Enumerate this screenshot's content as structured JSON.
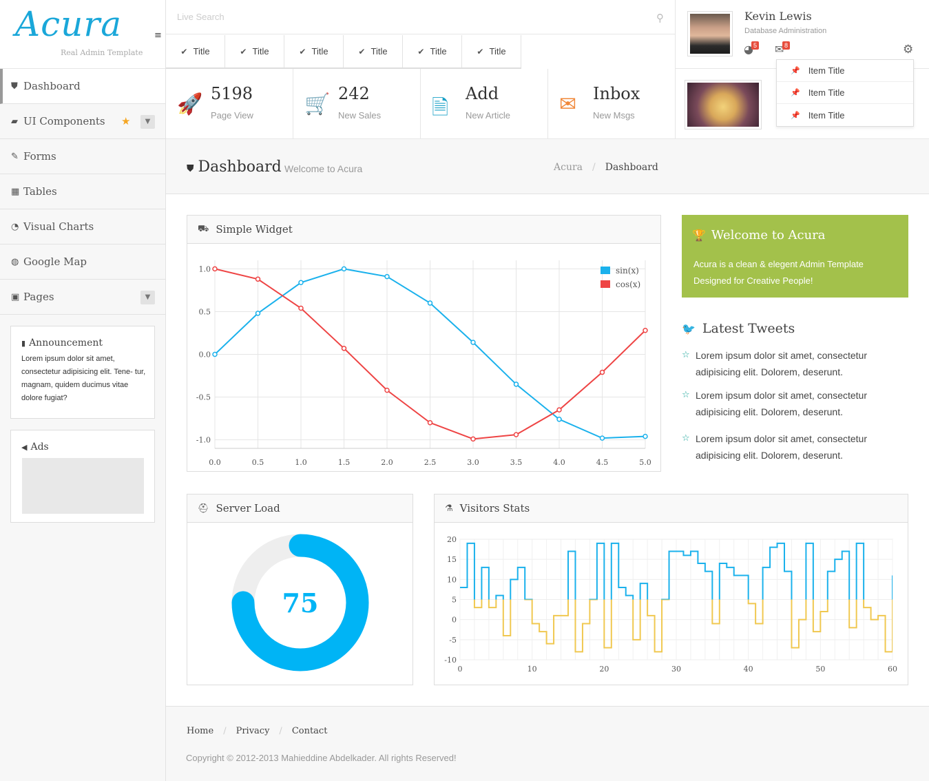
{
  "brand": {
    "logo": "Acura",
    "tagline": "Real Admin Template"
  },
  "search": {
    "placeholder": "Live Search"
  },
  "toolbar_tabs": [
    "Title",
    "Title",
    "Title",
    "Title",
    "Title",
    "Title"
  ],
  "user": {
    "name": "Kevin Lewis",
    "role": "Database Administration",
    "notifications_count": "5",
    "messages_count": "8"
  },
  "dropdown": {
    "items": [
      "Item Title",
      "Item Title",
      "Item Title"
    ]
  },
  "sidebar": {
    "items": [
      {
        "label": "Dashboard",
        "icon": "shield-icon"
      },
      {
        "label": "UI Components",
        "icon": "briefcase-icon"
      },
      {
        "label": "Forms",
        "icon": "edit-icon"
      },
      {
        "label": "Tables",
        "icon": "table-icon"
      },
      {
        "label": "Visual Charts",
        "icon": "dashboard-icon"
      },
      {
        "label": "Google Map",
        "icon": "globe-icon"
      },
      {
        "label": "Pages",
        "icon": "gift-icon"
      }
    ],
    "announcement": {
      "title": "Announcement",
      "text": "Lorem ipsum dolor sit amet, consectetur adipisicing elit. Tene- tur, magnam, quidem ducimus vitae dolore fugiat?"
    },
    "ads": {
      "title": "Ads"
    }
  },
  "stats": [
    {
      "value": "5198",
      "label": "Page View",
      "color": "#e74c3c",
      "icon": "rocket-icon"
    },
    {
      "value": "242",
      "label": "New Sales",
      "color": "#7ecfb0",
      "icon": "cart-icon"
    },
    {
      "value": "Add",
      "label": "New Article",
      "color": "#1ba1c7",
      "icon": "document-icon"
    },
    {
      "value": "Inbox",
      "label": "New Msgs",
      "color": "#f0883a",
      "icon": "envelope-icon"
    }
  ],
  "page": {
    "title": "Dashboard",
    "subtitle": "Welcome to Acura",
    "breadcrumb": [
      "Acura",
      "Dashboard"
    ]
  },
  "widgets": {
    "simple": {
      "title": "Simple Widget"
    },
    "server": {
      "title": "Server Load"
    },
    "visitors": {
      "title": "Visitors Stats"
    }
  },
  "welcome": {
    "title": "Welcome to Acura",
    "text": "Acura is a clean & elegent Admin Template Designed for Creative People!"
  },
  "tweets": {
    "title": "Latest Tweets",
    "items": [
      "Lorem ipsum dolor sit amet, consectetur adipisicing elit. Dolorem, deserunt.",
      "Lorem ipsum dolor sit amet, consectetur adipisicing elit. Dolorem, deserunt.",
      "Lorem ipsum dolor sit amet, consectetur adipisicing elit. Dolorem, deserunt."
    ]
  },
  "footer": {
    "links": [
      "Home",
      "Privacy",
      "Contact"
    ],
    "copyright": "Copyright © 2012-2013 Mahieddine Abdelkader. All rights Reserved!"
  },
  "colors": {
    "accent": "#1aa7d9",
    "sin": "#1ab1ec",
    "cos": "#ee4444",
    "gauge": "#00b4f5",
    "welcome": "#a3c14b",
    "stair_pos": "#1ab1ec",
    "stair_neg": "#f0c850"
  },
  "chart_data": [
    {
      "type": "line",
      "title": "",
      "x": [
        0.0,
        0.5,
        1.0,
        1.5,
        2.0,
        2.5,
        3.0,
        3.5,
        4.0,
        4.5,
        5.0
      ],
      "x_ticks": [
        "0.0",
        "0.5",
        "1.0",
        "1.5",
        "2.0",
        "2.5",
        "3.0",
        "3.5",
        "4.0",
        "4.5",
        "5.0"
      ],
      "y_ticks": [
        "1.0",
        "0.5",
        "0.0",
        "-0.5",
        "-1.0"
      ],
      "xlim": [
        0,
        5
      ],
      "ylim": [
        -1.1,
        1.1
      ],
      "grid": true,
      "legend": "top-right",
      "series": [
        {
          "name": "sin(x)",
          "values": [
            0.0,
            0.48,
            0.84,
            1.0,
            0.91,
            0.6,
            0.14,
            -0.35,
            -0.76,
            -0.98,
            -0.96
          ]
        },
        {
          "name": "cos(x)",
          "values": [
            1.0,
            0.88,
            0.54,
            0.07,
            -0.42,
            -0.8,
            -0.99,
            -0.94,
            -0.65,
            -0.21,
            0.28
          ]
        }
      ]
    },
    {
      "type": "gauge",
      "value": 75,
      "max": 100,
      "label": "75"
    },
    {
      "type": "area",
      "step": true,
      "x_ticks": [
        "0",
        "10",
        "20",
        "30",
        "40",
        "50",
        "60"
      ],
      "y_ticks": [
        "20",
        "15",
        "10",
        "5",
        "0",
        "-5",
        "-10"
      ],
      "xlim": [
        0,
        60
      ],
      "ylim": [
        -10,
        20
      ],
      "baseline": 5,
      "grid": true,
      "values": [
        8,
        19,
        3,
        13,
        3,
        6,
        -4,
        10,
        13,
        5,
        -1,
        -3,
        -6,
        1,
        1,
        17,
        -8,
        -1,
        5,
        19,
        -7,
        19,
        8,
        6,
        -5,
        9,
        1,
        -8,
        5,
        17,
        17,
        16,
        17,
        14,
        12,
        -1,
        14,
        13,
        11,
        11,
        4,
        -1,
        13,
        18,
        19,
        12,
        -7,
        0,
        19,
        -3,
        2,
        12,
        15,
        17,
        -2,
        19,
        3,
        0,
        1,
        -8,
        11
      ]
    }
  ]
}
